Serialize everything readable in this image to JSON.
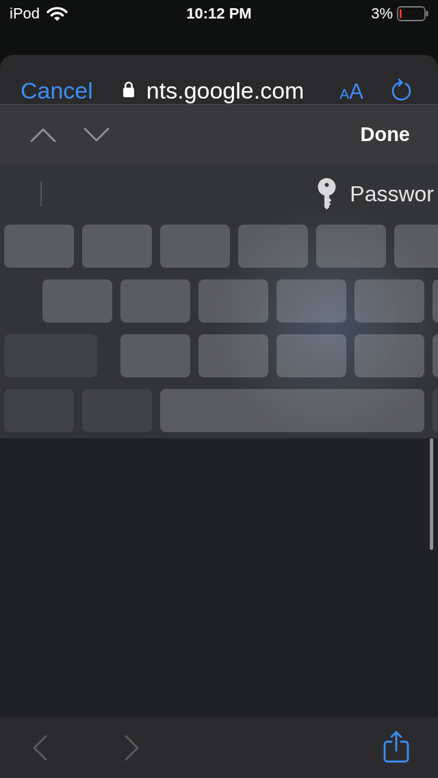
{
  "status_bar": {
    "carrier": "iPod",
    "time": "10:12 PM",
    "battery": "3%"
  },
  "nav_bar": {
    "cancel": "Cancel",
    "url": "nts.google.com",
    "text_size": {
      "small": "A",
      "large": "A"
    }
  },
  "form_toolbar": {
    "previous": {
      "disabled": true
    },
    "next": {
      "disabled": true
    },
    "done": "Done"
  },
  "keyboard": {
    "suggestion": "Passwor",
    "rows": [
      [
        {
          "kind": "letter"
        },
        {
          "kind": "letter"
        },
        {
          "kind": "letter"
        },
        {
          "kind": "letter"
        },
        {
          "kind": "letter"
        },
        {
          "kind": "letter"
        }
      ],
      [
        {
          "kind": "letter"
        },
        {
          "kind": "letter"
        },
        {
          "kind": "letter"
        },
        {
          "kind": "letter"
        },
        {
          "kind": "letter"
        },
        {
          "kind": "letter"
        }
      ],
      [
        {
          "kind": "shift"
        },
        {
          "kind": "letter"
        },
        {
          "kind": "letter"
        },
        {
          "kind": "letter"
        },
        {
          "kind": "letter"
        },
        {
          "kind": "letter"
        }
      ],
      [
        {
          "kind": "function"
        },
        {
          "kind": "function"
        },
        {
          "kind": "space"
        },
        {
          "kind": "function"
        }
      ]
    ]
  },
  "toolbar": {
    "back": {
      "disabled": true
    },
    "forward": {
      "disabled": true
    }
  }
}
